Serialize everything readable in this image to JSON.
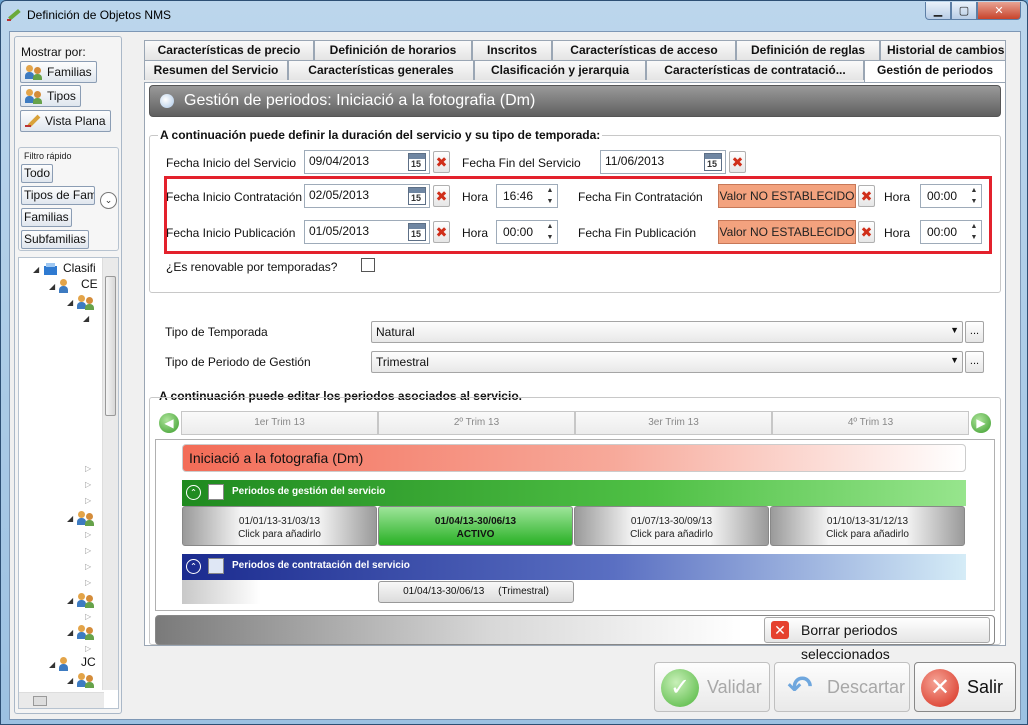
{
  "window": {
    "title": "Definición de Objetos NMS"
  },
  "sidebar": {
    "mostrar_label": "Mostrar por:",
    "buttons": [
      "Familias",
      "Tipos",
      "Vista Plana"
    ],
    "filtro_label": "Filtro rápido",
    "filtro_buttons": [
      "Todo",
      "Tipos de Fam",
      "Familias",
      "Subfamilias"
    ],
    "tree": [
      "Clasifi",
      "CE",
      "JC"
    ]
  },
  "tabs": {
    "row1": [
      "Características de precio",
      "Definición de horarios",
      "Inscritos",
      "Características de acceso",
      "Definición de reglas",
      "Historial de cambios"
    ],
    "row2": [
      "Resumen del Servicio",
      "Características generales",
      "Clasificación y jerarquia",
      "Características de contratació...",
      "Gestión de periodos"
    ]
  },
  "header": {
    "title": "Gestión de periodos: Iniciació a la fotografia (Dm)"
  },
  "duration": {
    "section_title": "A continuación puede definir la duración del servicio y su tipo de temporada:",
    "fecha_inicio_servicio_label": "Fecha Inicio del Servicio",
    "fecha_inicio_servicio": "09/04/2013",
    "fecha_fin_servicio_label": "Fecha Fin del Servicio",
    "fecha_fin_servicio": "11/06/2013",
    "fecha_inicio_contratacion_label": "Fecha Inicio Contratación",
    "fecha_inicio_contratacion": "02/05/2013",
    "hora_label": "Hora",
    "hora_inicio_contratacion": "16:46",
    "fecha_fin_contratacion_label": "Fecha Fin Contratación",
    "fecha_fin_contratacion": "Valor NO ESTABLECIDO",
    "hora_fin_contratacion": "00:00",
    "fecha_inicio_publicacion_label": "Fecha Inicio Publicación",
    "fecha_inicio_publicacion": "01/05/2013",
    "hora_inicio_publicacion": "00:00",
    "fecha_fin_publicacion_label": "Fecha Fin Publicación",
    "fecha_fin_publicacion": "Valor NO ESTABLECIDO",
    "hora_fin_publicacion": "00:00",
    "calendar_day": "15",
    "renovable_label": "¿Es renovable por temporadas?",
    "tipo_temporada_label": "Tipo de Temporada",
    "tipo_temporada": "Natural",
    "tipo_periodo_label": "Tipo de Periodo de Gestión",
    "tipo_periodo": "Trimestral"
  },
  "periods": {
    "section_title": "A continuación puede editar los periodos asociados al servicio.",
    "quarters": [
      "1er Trim 13",
      "2º Trim 13",
      "3er Trim 13",
      "4º Trim 13"
    ],
    "service_name": "Iniciació a la fotografia (Dm)",
    "gestion_title": "Periodos de gestión del servicio",
    "gestion_cells": [
      {
        "range": "01/01/13-31/03/13",
        "status": "Click para añadirlo"
      },
      {
        "range": "01/04/13-30/06/13",
        "status": "ACTIVO"
      },
      {
        "range": "01/07/13-30/09/13",
        "status": "Click para añadirlo"
      },
      {
        "range": "01/10/13-31/12/13",
        "status": "Click para añadirlo"
      }
    ],
    "contratacion_title": "Periodos de contratación del servicio",
    "contratacion_item": "01/04/13-30/06/13     (Trimestral)",
    "borrar_label": "Borrar periodos seleccionados"
  },
  "footer": {
    "validar": "Validar",
    "descartar": "Descartar",
    "salir": "Salir"
  },
  "colors": {
    "active_green": "#29b025",
    "not_set": "#f3a27e",
    "highlight_red": "#e3212c",
    "contratacion_blue": "#2a3a9e"
  }
}
